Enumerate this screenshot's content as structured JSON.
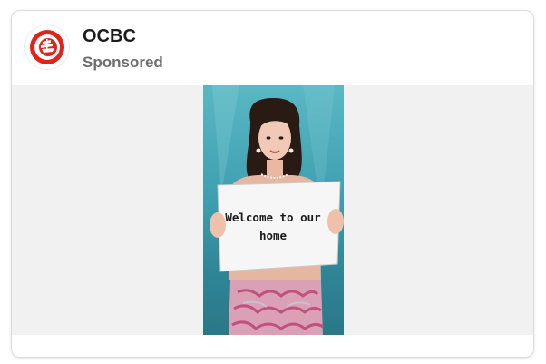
{
  "post": {
    "brand_name": "OCBC",
    "sponsored_label": "Sponsored",
    "logo_icon": "ocbc-logo-icon",
    "brand_color": "#e2231a"
  },
  "media": {
    "sign_text": "Welcome to our home"
  }
}
